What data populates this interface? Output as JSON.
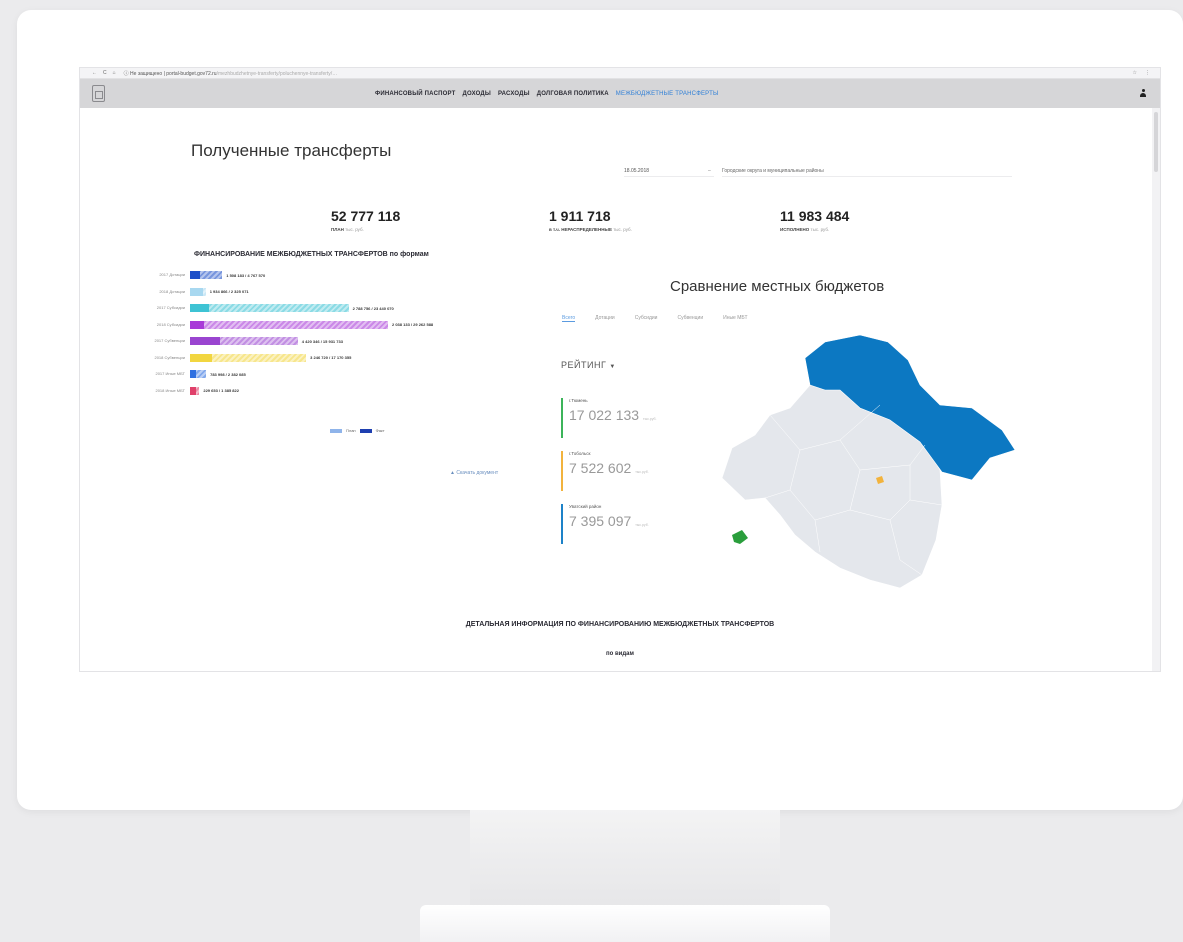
{
  "browser": {
    "nav_icons": [
      "←",
      "C",
      "⌂"
    ],
    "url_host": "ⓘ Не защищено | portal-budget.gov72.ru",
    "url_path": "/mezhbudzhetnye-transferty/poluchennye-transferty/…",
    "right_icons": [
      "☆",
      "⋮"
    ]
  },
  "header": {
    "nav": [
      {
        "label": "ФИНАНСОВЫЙ ПАСПОРТ",
        "active": false
      },
      {
        "label": "ДОХОДЫ",
        "active": false
      },
      {
        "label": "РАСХОДЫ",
        "active": false
      },
      {
        "label": "ДОЛГОВАЯ ПОЛИТИКА",
        "active": false
      },
      {
        "label": "МЕЖБЮДЖЕТНЫЕ ТРАНСФЕРТЫ",
        "active": true
      }
    ]
  },
  "page": {
    "title": "Полученные трансферты",
    "filter_date": "18.05.2018",
    "filter_dash": "–",
    "filter_region": "Городские округа и муниципальные районы"
  },
  "kpis": [
    {
      "value": "52 777 118",
      "caption": "ПЛАН",
      "unit": "тыс. руб."
    },
    {
      "value": "1 911 718",
      "caption": "в т.ч. НЕРАСПРЕДЕЛЕННЫЕ",
      "unit": "тыс. руб."
    },
    {
      "value": "11 983 484",
      "caption": "ИСПОЛНЕНО",
      "unit": "тыс. руб."
    }
  ],
  "funding_chart": {
    "title": "ФИНАНСИРОВАНИЕ МЕЖБЮДЖЕТНЫХ ТРАНСФЕРТОВ по формам",
    "legend_plan": "План",
    "legend_fact": "Факт",
    "download_label": "Скачать документ",
    "download_icon": "download-icon"
  },
  "chart_data": {
    "type": "bar",
    "orientation": "horizontal",
    "categories": [
      "2017 Дотации",
      "2018 Дотации",
      "2017 Субсидии",
      "2018 Субсидии",
      "2017 Субвенции",
      "2018 Субвенции",
      "2017 Иные МБТ",
      "2018 Иные МБТ"
    ],
    "series": [
      {
        "name": "План",
        "values": [
          4767,
          2325,
          23440,
          29262,
          15931,
          17170,
          2382,
          1385
        ]
      },
      {
        "name": "Факт",
        "values": [
          1508,
          1934,
          2788,
          2038,
          4420,
          3246,
          783,
          229
        ]
      }
    ],
    "value_labels": [
      "1 508 183 / 4 767 570",
      "1 934 866 / 2 325 071",
      "2 788 756 / 23 440 070",
      "2 038 133 / 29 262 588",
      "4 420 346 / 15 931 733",
      "3 246 720 / 17 170 355",
      "783 998 / 2 382 085",
      "229 653 / 1 385 822"
    ],
    "colors": [
      "#1e4fc8",
      "#a8d8f0",
      "#3ec3d4",
      "#a83ad8",
      "#9a45d0",
      "#f2d640",
      "#2f6fe0",
      "#e0406a"
    ],
    "legend": "bottom"
  },
  "compare": {
    "title": "Сравнение местных бюджетов",
    "tabs": [
      {
        "label": "Всего",
        "active": true
      },
      {
        "label": "Дотации",
        "active": false
      },
      {
        "label": "Субсидии",
        "active": false
      },
      {
        "label": "Субвенции",
        "active": false
      },
      {
        "label": "Иные МБТ",
        "active": false
      }
    ],
    "rating_title": "РЕЙТИНГ",
    "rating_sort_icon": "sort-icon",
    "rating": [
      {
        "name": "г.Тюмень",
        "value": "17 022 133",
        "unit": "тыс.руб.",
        "color": "#3cb45a"
      },
      {
        "name": "г.Тобольск",
        "value": "7 522 602",
        "unit": "тыс.руб.",
        "color": "#f2b33d"
      },
      {
        "name": "Уватский район",
        "value": "7 395 097",
        "unit": "тыс.руб.",
        "color": "#1d82c8"
      }
    ],
    "map_colors": {
      "base": "#e4e7ec",
      "highlight": "#0c78c2",
      "green": "#2a9e3c",
      "yellow": "#f2b33d"
    }
  },
  "detail": {
    "title": "ДЕТАЛЬНАЯ ИНФОРМАЦИЯ ПО ФИНАНСИРОВАНИЮ МЕЖБЮДЖЕТНЫХ ТРАНСФЕРТОВ",
    "subtitle": "по видам"
  }
}
